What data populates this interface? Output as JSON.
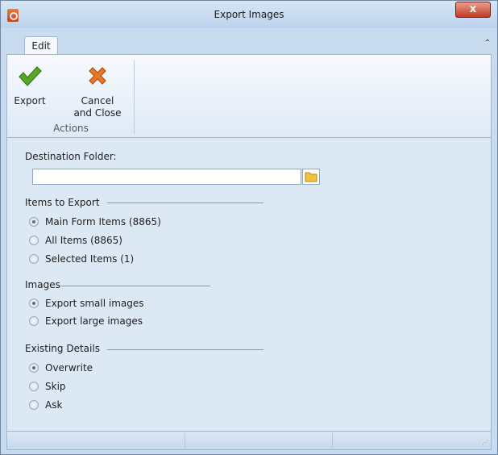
{
  "window": {
    "title": "Export Images",
    "close_glyph": "x",
    "app_icon": "app-icon"
  },
  "ribbon": {
    "tab_label": "Edit",
    "collapse_glyph": "⌃",
    "export_label": "Export",
    "cancel_label_line1": "Cancel",
    "cancel_label_line2": "and Close",
    "group_label": "Actions",
    "export_icon": "checkmark-icon",
    "cancel_icon": "x-mark-icon",
    "colors": {
      "check_green": "#5aa626",
      "cross_orange": "#e8772a"
    }
  },
  "form": {
    "destination_label": "Destination Folder:",
    "destination_value": "",
    "items_group": {
      "title": "Items to Export",
      "options": [
        "Main Form Items (8865)",
        "All Items (8865)",
        "Selected Items (1)"
      ],
      "selected": 0
    },
    "images_group": {
      "title": "Images",
      "options": [
        "Export small images",
        "Export large images"
      ],
      "selected": 0
    },
    "existing_group": {
      "title": "Existing Details",
      "options": [
        "Overwrite",
        "Skip",
        "Ask"
      ],
      "selected": 0
    }
  }
}
